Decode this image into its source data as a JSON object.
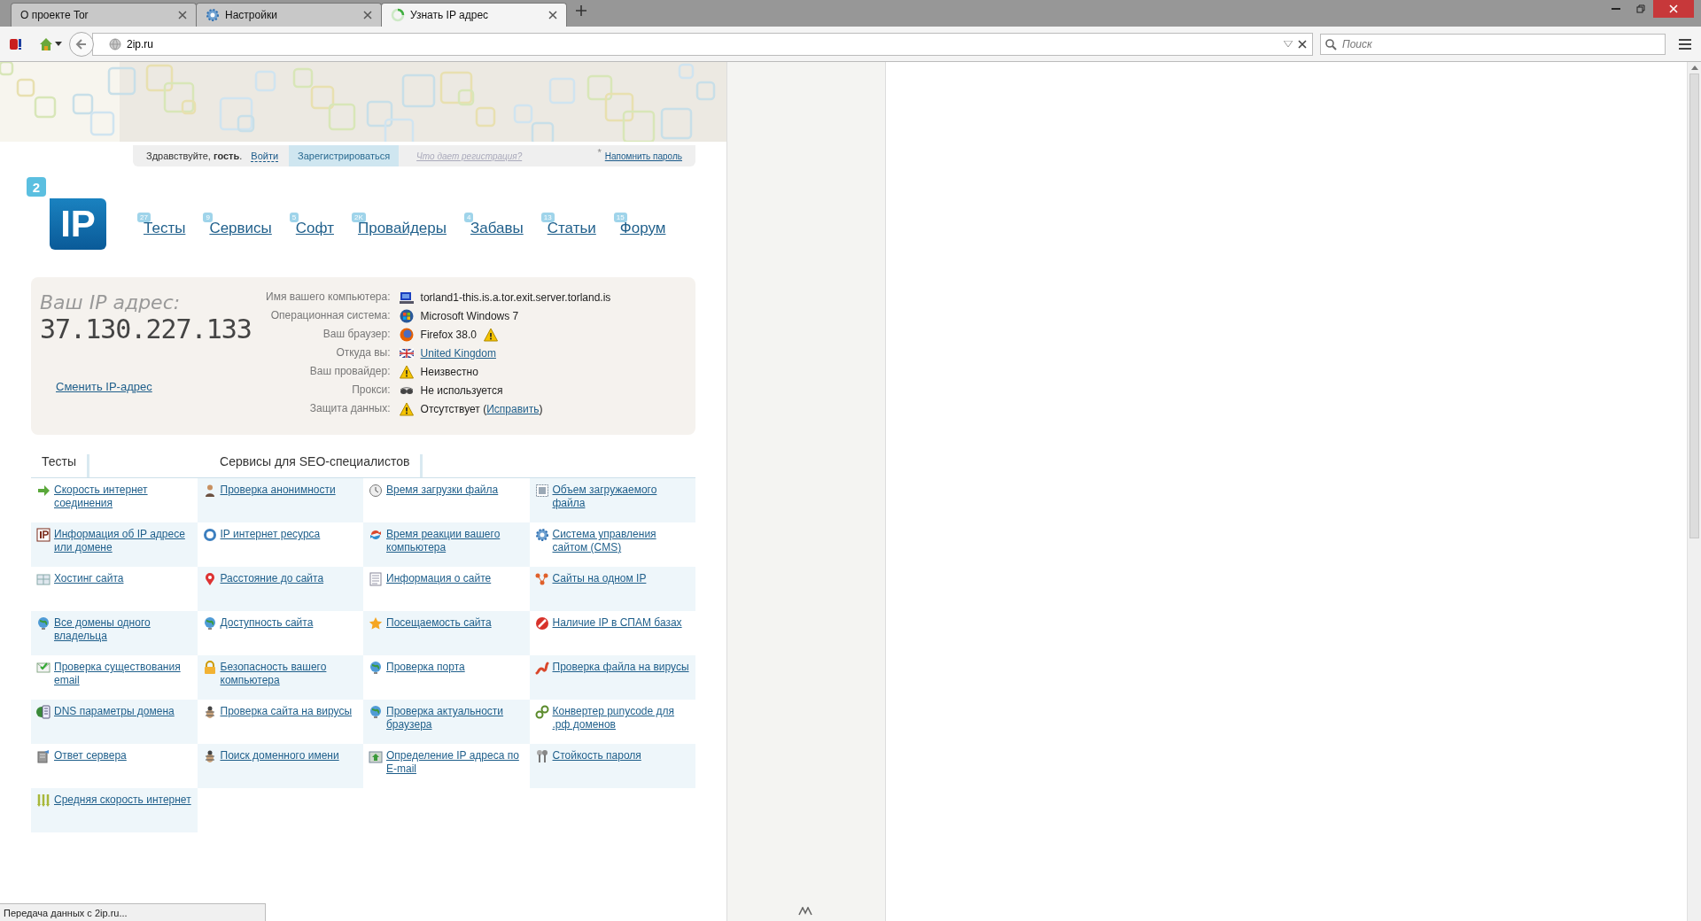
{
  "browser": {
    "tabs": [
      {
        "title": "О проекте Tor",
        "selected": false
      },
      {
        "title": "Настройки",
        "selected": false
      },
      {
        "title": "Узнать IP адрес",
        "selected": true
      }
    ],
    "address": "2ip.ru",
    "search": {
      "placeholder": "Поиск"
    }
  },
  "site": {
    "login_bar": {
      "greeting": "Здравствуйте, **гость**.",
      "login": "Войти",
      "register": "Зарегистрироваться",
      "why": "Что дает регистрация?",
      "star": "*",
      "remind": "Напомнить пароль"
    },
    "logo": {
      "badge": "2",
      "text": "IP"
    },
    "nav": [
      {
        "label": "Тесты",
        "count": "27"
      },
      {
        "label": "Сервисы",
        "count": "9"
      },
      {
        "label": "Софт",
        "count": "5"
      },
      {
        "label": "Провайдеры",
        "count": "2K"
      },
      {
        "label": "Забавы",
        "count": "4"
      },
      {
        "label": "Статьи",
        "count": "13"
      },
      {
        "label": "Форум",
        "count": "15"
      }
    ],
    "ip_panel": {
      "heading": "Ваш IP адрес:",
      "ip": "37.130.227.133",
      "change_link": "Сменить IP-адрес",
      "rows": [
        {
          "label": "Имя вашего компьютера:",
          "value": "torland1-this.is.a.tor.exit.server.torland.is"
        },
        {
          "label": "Операционная система:",
          "value": "Microsoft Windows 7"
        },
        {
          "label": "Ваш браузер:",
          "value": "Firefox 38.0",
          "warning": true
        },
        {
          "label": "Откуда вы:",
          "link": "United Kingdom"
        },
        {
          "label": "Ваш провайдер:",
          "value": "Неизвестно"
        },
        {
          "label": "Прокси:",
          "value": "Не используется"
        },
        {
          "label": "Защита данных:",
          "value": "Отсутствует (",
          "link": "Исправить",
          "tail": ")"
        }
      ]
    },
    "sections": [
      "Тесты",
      "Сервисы для SEO-специалистов"
    ],
    "services": [
      "Скорость интернет соединения",
      "Проверка анонимности",
      "Время загрузки файла",
      "Объем загружаемого файла",
      "Информация об IP адресе или домене",
      "IP интернет ресурса",
      "Время реакции вашего компьютера",
      "Система управления сайтом (CMS)",
      "Хостинг сайта",
      "Расстояние до сайта",
      "Информация о сайте",
      "Сайты на одном IP",
      "Все домены одного владельца",
      "Доступность сайта",
      "Посещаемость сайта",
      "Наличие IP в СПАМ базах",
      "Проверка существования email",
      "Безопасность вашего компьютера",
      "Проверка порта",
      "Проверка файла на вирусы",
      "DNS параметры домена",
      "Проверка сайта на вирусы",
      "Проверка актуальности браузера",
      "Конвертер punycode для .рф доменов",
      "Ответ сервера",
      "Поиск доменного имени",
      "Определение IP адреса по E-mail",
      "Стойкость пароля",
      "Средняя скорость интернет"
    ]
  },
  "status_bar": "Передача данных с 2ip.ru..."
}
